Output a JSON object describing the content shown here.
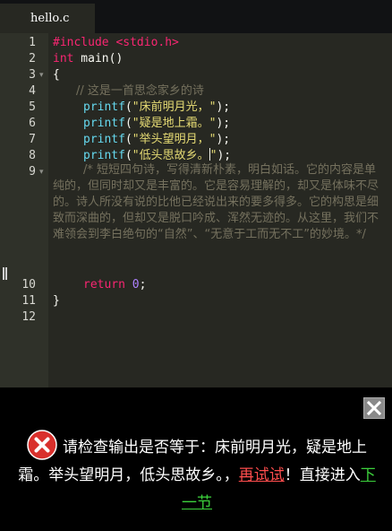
{
  "tab": {
    "filename": "hello.c"
  },
  "editor": {
    "line_numbers": [
      "1",
      "2",
      "3",
      "4",
      "5",
      "6",
      "7",
      "8",
      "9",
      "10",
      "11",
      "12"
    ],
    "lines": {
      "l1": "#include <stdio.h>",
      "l2_type": "int",
      "l2_rest": " main()",
      "l3": "{",
      "l4_comment": "// 这是一首思念家乡的诗",
      "printf": "printf",
      "l5_str": "\"床前明月光，\"",
      "l6_str": "\"疑是地上霜。\"",
      "l7_str": "\"举头望明月，\"",
      "l8_str": "\"低头思故乡。",
      "l8_str_end": "\"",
      "open_paren": "(",
      "close_semi": ");",
      "l9_comment": "/* 短短四句诗，写得清新朴素，明白如话。它的内容是单纯的，但同时却又是丰富的。它是容易理解的，却又是体味不尽的。诗人所没有说的比他已经说出来的要多得多。它的构思是细致而深曲的，但却又是脱口吟成、浑然无迹的。从这里，我们不难领会到李白绝句的“自然”、“无意于工而无不工”的妙境。*/",
      "l10_kw": "return",
      "l10_num": "0",
      "l10_semi": ";",
      "l11": "}"
    }
  },
  "feedback": {
    "message": "请检查输出是否等于：床前明月光，疑是地上霜。举头望明月，低头思故乡。，",
    "retry_label": "再试试",
    "middle": "！直接进入",
    "next_label": "下一节",
    "colors": {
      "retry": "#ff4d4d",
      "next": "#3cd13c",
      "error_icon": "#d9302c"
    }
  }
}
